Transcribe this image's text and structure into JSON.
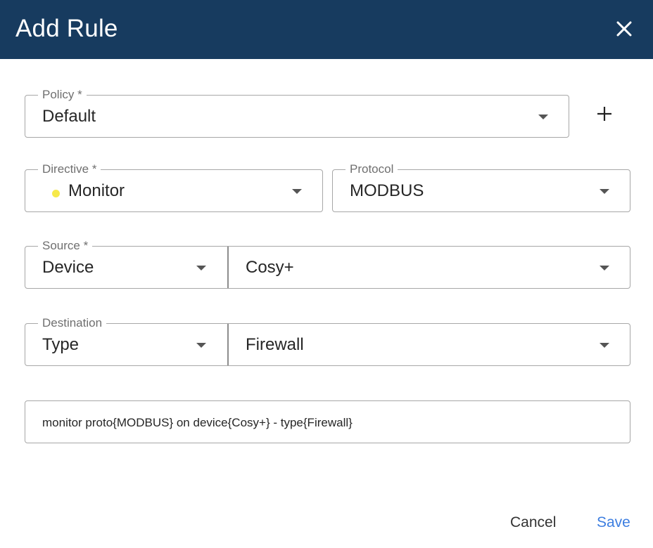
{
  "dialog": {
    "title": "Add Rule",
    "close_icon": "close-icon"
  },
  "policy": {
    "label": "Policy *",
    "value": "Default",
    "add_icon": "plus-icon"
  },
  "directive": {
    "label": "Directive *",
    "value": "Monitor",
    "dot_color": "#f6e94a"
  },
  "protocol": {
    "label": "Protocol",
    "value": "MODBUS"
  },
  "source": {
    "label": "Source *",
    "kind": "Device",
    "value": "Cosy+"
  },
  "destination": {
    "label": "Destination",
    "kind": "Type",
    "value": "Firewall"
  },
  "rule_text": "monitor proto{MODBUS} on device{Cosy+} - type{Firewall}",
  "actions": {
    "cancel_label": "Cancel",
    "save_label": "Save"
  },
  "colors": {
    "header_bg": "#173b5f",
    "accent": "#3d7ee0"
  }
}
